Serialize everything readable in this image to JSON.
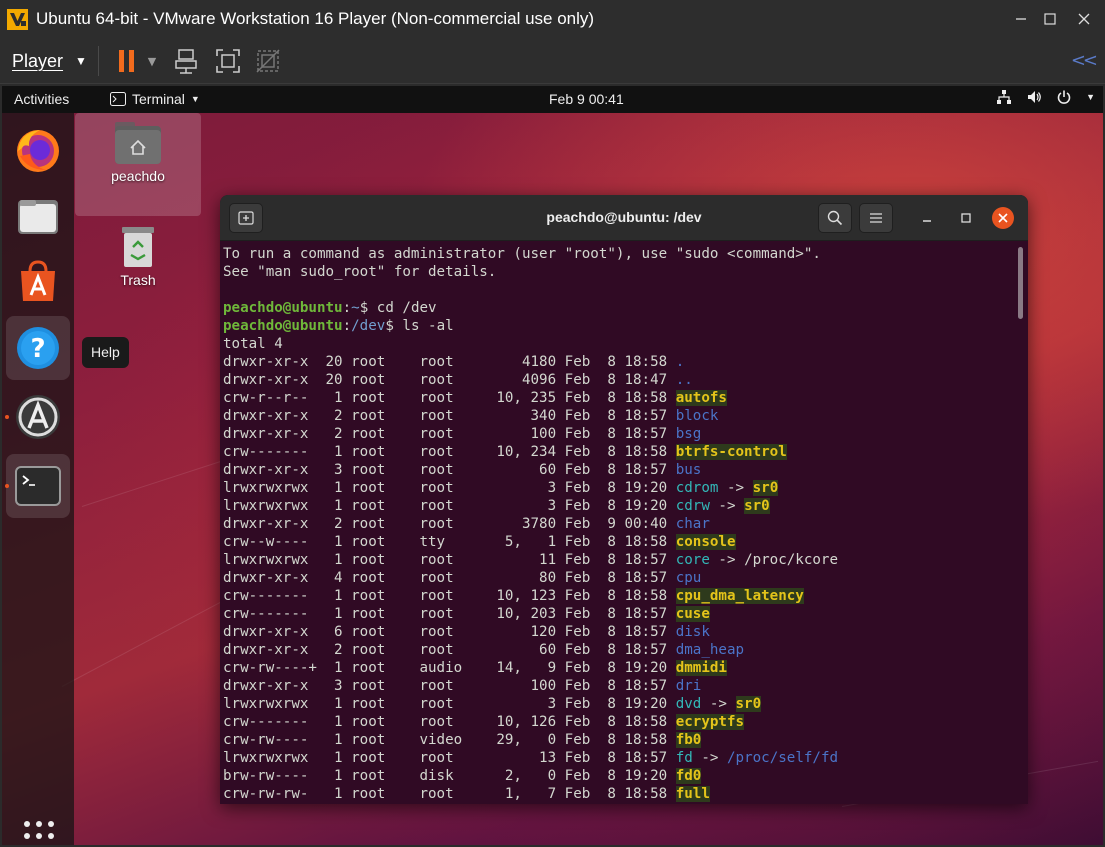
{
  "vm": {
    "title": "Ubuntu 64-bit - VMware Workstation 16 Player (Non-commercial use only)",
    "player_label": "Player",
    "accent": "#f26b1d",
    "toolbar_icons": [
      "pause-icon",
      "send-ctrl-alt-del-icon",
      "fit-guest-icon",
      "unity-mode-icon"
    ]
  },
  "topbar": {
    "activities": "Activities",
    "app_name": "Terminal",
    "clock": "Feb 9  00:41"
  },
  "dock": {
    "tooltip": "Help",
    "items": [
      "firefox-icon",
      "files-icon",
      "ubuntu-software-icon",
      "help-icon",
      "software-updater-icon",
      "terminal-icon"
    ]
  },
  "desktop": {
    "home_label": "peachdo",
    "trash_label": "Trash"
  },
  "terminal": {
    "title": "peachdo@ubuntu: /dev",
    "intro": [
      "To run a command as administrator (user \"root\"), use \"sudo <command>\".",
      "See \"man sudo_root\" for details."
    ],
    "prompts": [
      {
        "user": "peachdo@ubuntu",
        "path": "~",
        "cmd": "cd /dev"
      },
      {
        "user": "peachdo@ubuntu",
        "path": "/dev",
        "cmd": "ls -al"
      }
    ],
    "total": "total 4",
    "rows": [
      {
        "perm": "drwxr-xr-x",
        "links": "20",
        "owner": "root",
        "group": "root",
        "size": "4180",
        "date": "Feb  8 18:58",
        "name": ".",
        "kind": "dir"
      },
      {
        "perm": "drwxr-xr-x",
        "links": "20",
        "owner": "root",
        "group": "root",
        "size": "4096",
        "date": "Feb  8 18:47",
        "name": "..",
        "kind": "dir"
      },
      {
        "perm": "crw-r--r--",
        "links": "1",
        "owner": "root",
        "group": "root",
        "size": "10, 235",
        "date": "Feb  8 18:58",
        "name": "autofs",
        "kind": "dev"
      },
      {
        "perm": "drwxr-xr-x",
        "links": "2",
        "owner": "root",
        "group": "root",
        "size": "340",
        "date": "Feb  8 18:57",
        "name": "block",
        "kind": "dir"
      },
      {
        "perm": "drwxr-xr-x",
        "links": "2",
        "owner": "root",
        "group": "root",
        "size": "100",
        "date": "Feb  8 18:57",
        "name": "bsg",
        "kind": "dir"
      },
      {
        "perm": "crw-------",
        "links": "1",
        "owner": "root",
        "group": "root",
        "size": "10, 234",
        "date": "Feb  8 18:58",
        "name": "btrfs-control",
        "kind": "dev"
      },
      {
        "perm": "drwxr-xr-x",
        "links": "3",
        "owner": "root",
        "group": "root",
        "size": "60",
        "date": "Feb  8 18:57",
        "name": "bus",
        "kind": "dir"
      },
      {
        "perm": "lrwxrwxrwx",
        "links": "1",
        "owner": "root",
        "group": "root",
        "size": "3",
        "date": "Feb  8 19:20",
        "name": "cdrom",
        "kind": "link",
        "arrow": " -> ",
        "target": "sr0",
        "target_kind": "dev"
      },
      {
        "perm": "lrwxrwxrwx",
        "links": "1",
        "owner": "root",
        "group": "root",
        "size": "3",
        "date": "Feb  8 19:20",
        "name": "cdrw",
        "kind": "link",
        "arrow": " -> ",
        "target": "sr0",
        "target_kind": "dev"
      },
      {
        "perm": "drwxr-xr-x",
        "links": "2",
        "owner": "root",
        "group": "root",
        "size": "3780",
        "date": "Feb  9 00:40",
        "name": "char",
        "kind": "dir"
      },
      {
        "perm": "crw--w----",
        "links": "1",
        "owner": "root",
        "group": "tty",
        "size": "5,   1",
        "date": "Feb  8 18:58",
        "name": "console",
        "kind": "dev"
      },
      {
        "perm": "lrwxrwxrwx",
        "links": "1",
        "owner": "root",
        "group": "root",
        "size": "11",
        "date": "Feb  8 18:57",
        "name": "core",
        "kind": "link",
        "arrow": " -> ",
        "target": "/proc/kcore",
        "target_kind": "plain"
      },
      {
        "perm": "drwxr-xr-x",
        "links": "4",
        "owner": "root",
        "group": "root",
        "size": "80",
        "date": "Feb  8 18:57",
        "name": "cpu",
        "kind": "dir"
      },
      {
        "perm": "crw-------",
        "links": "1",
        "owner": "root",
        "group": "root",
        "size": "10, 123",
        "date": "Feb  8 18:58",
        "name": "cpu_dma_latency",
        "kind": "dev"
      },
      {
        "perm": "crw-------",
        "links": "1",
        "owner": "root",
        "group": "root",
        "size": "10, 203",
        "date": "Feb  8 18:57",
        "name": "cuse",
        "kind": "dev"
      },
      {
        "perm": "drwxr-xr-x",
        "links": "6",
        "owner": "root",
        "group": "root",
        "size": "120",
        "date": "Feb  8 18:57",
        "name": "disk",
        "kind": "dir"
      },
      {
        "perm": "drwxr-xr-x",
        "links": "2",
        "owner": "root",
        "group": "root",
        "size": "60",
        "date": "Feb  8 18:57",
        "name": "dma_heap",
        "kind": "dir"
      },
      {
        "perm": "crw-rw----+",
        "links": "1",
        "owner": "root",
        "group": "audio",
        "size": "14,   9",
        "date": "Feb  8 19:20",
        "name": "dmmidi",
        "kind": "dev"
      },
      {
        "perm": "drwxr-xr-x",
        "links": "3",
        "owner": "root",
        "group": "root",
        "size": "100",
        "date": "Feb  8 18:57",
        "name": "dri",
        "kind": "dir"
      },
      {
        "perm": "lrwxrwxrwx",
        "links": "1",
        "owner": "root",
        "group": "root",
        "size": "3",
        "date": "Feb  8 19:20",
        "name": "dvd",
        "kind": "link",
        "arrow": " -> ",
        "target": "sr0",
        "target_kind": "dev"
      },
      {
        "perm": "crw-------",
        "links": "1",
        "owner": "root",
        "group": "root",
        "size": "10, 126",
        "date": "Feb  8 18:58",
        "name": "ecryptfs",
        "kind": "dev"
      },
      {
        "perm": "crw-rw----",
        "links": "1",
        "owner": "root",
        "group": "video",
        "size": "29,   0",
        "date": "Feb  8 18:58",
        "name": "fb0",
        "kind": "dev"
      },
      {
        "perm": "lrwxrwxrwx",
        "links": "1",
        "owner": "root",
        "group": "root",
        "size": "13",
        "date": "Feb  8 18:57",
        "name": "fd",
        "kind": "link",
        "arrow": " -> ",
        "target": "/proc/self/fd",
        "target_kind": "dir"
      },
      {
        "perm": "brw-rw----",
        "links": "1",
        "owner": "root",
        "group": "disk",
        "size": "2,   0",
        "date": "Feb  8 19:20",
        "name": "fd0",
        "kind": "dev"
      },
      {
        "perm": "crw-rw-rw-",
        "links": "1",
        "owner": "root",
        "group": "root",
        "size": "1,   7",
        "date": "Feb  8 18:58",
        "name": "full",
        "kind": "dev"
      }
    ]
  }
}
